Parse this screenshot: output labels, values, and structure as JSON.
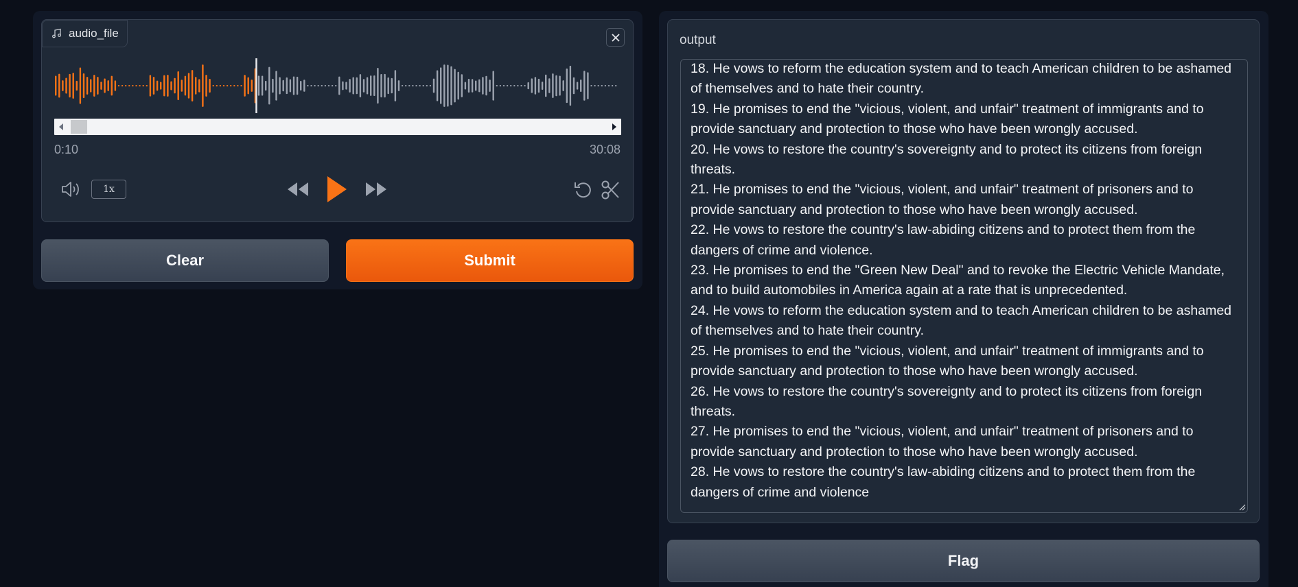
{
  "audio": {
    "label": "audio_file",
    "label_icon": "music-note-icon",
    "current_time": "0:10",
    "duration": "30:08",
    "speed": "1x",
    "played_fraction": 0.355,
    "colors": {
      "played": "#f97316",
      "unplayed": "#9ca3af",
      "cursor": "#e5e7eb"
    }
  },
  "buttons": {
    "clear": "Clear",
    "submit": "Submit",
    "flag": "Flag"
  },
  "output": {
    "label": "output",
    "lines": [
      "18. He vows to reform the education system and to teach American children to be ashamed",
      "of themselves and to hate their country.",
      "19. He promises to end the \"vicious, violent, and unfair\" treatment of immigrants and to",
      "provide sanctuary and protection to those who have been wrongly accused.",
      "20. He vows to restore the country's sovereignty and to protect its citizens from foreign",
      "threats.",
      "21. He promises to end the \"vicious, violent, and unfair\" treatment of prisoners and to",
      "provide sanctuary and protection to those who have been wrongly accused.",
      "22. He vows to restore the country's law-abiding citizens and to protect them from the",
      "dangers of crime and violence.",
      "23. He promises to end the \"Green New Deal\" and to revoke the Electric Vehicle Mandate,",
      "and to build automobiles in America again at a rate that is unprecedented.",
      "24. He vows to reform the education system and to teach American children to be ashamed",
      "of themselves and to hate their country.",
      "25. He promises to end the \"vicious, violent, and unfair\" treatment of immigrants and to",
      "provide sanctuary and protection to those who have been wrongly accused.",
      "26. He vows to restore the country's sovereignty and to protect its citizens from foreign",
      "threats.",
      "27. He promises to end the \"vicious, violent, and unfair\" treatment of prisoners and to",
      "provide sanctuary and protection to those who have been wrongly accused.",
      "28. He vows to restore the country's law-abiding citizens and to protect them from the",
      "dangers of crime and violence"
    ]
  },
  "theme": {
    "accent": "#f97316",
    "background": "#0b0f19",
    "panel": "#1f2937"
  }
}
